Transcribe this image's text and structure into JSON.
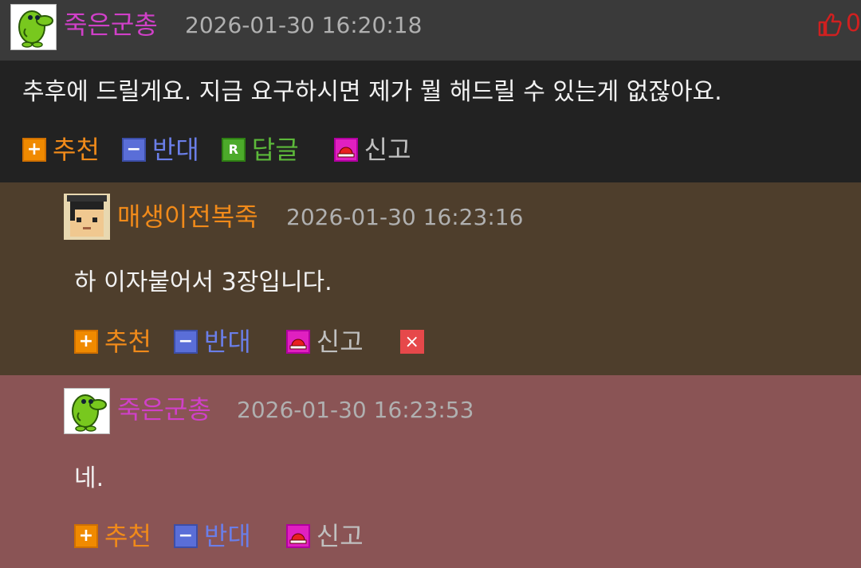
{
  "comments": [
    {
      "nickname": "죽은군총",
      "nick_color": "#d040c8",
      "timestamp": "2026-01-30 16:20:18",
      "text": "추후에 드릴게요. 지금 요구하시면 제가 뭘 해드릴 수 있는게 없잖아요.",
      "like_count": "0",
      "actions": {
        "recommend": "추천",
        "oppose": "반대",
        "reply": "답글",
        "report": "신고",
        "reply_icon": "R"
      }
    },
    {
      "nickname": "매생이전복죽",
      "nick_color": "#f08a1a",
      "timestamp": "2026-01-30 16:23:16",
      "text": "하 이자붙어서 3장입니다.",
      "actions": {
        "recommend": "추천",
        "oppose": "반대",
        "report": "신고",
        "delete_icon": "×"
      }
    },
    {
      "nickname": "죽은군총",
      "nick_color": "#d040c8",
      "timestamp": "2026-01-30 16:23:53",
      "text": "네.",
      "actions": {
        "recommend": "추천",
        "oppose": "반대",
        "report": "신고"
      }
    }
  ],
  "icons": {
    "recommend": "plus-icon",
    "oppose": "minus-icon",
    "reply": "reply-icon",
    "report": "siren-icon",
    "like": "thumbs-up-icon",
    "delete": "close-icon"
  },
  "colors": {
    "comment1_bg": "#222222",
    "comment2_bg": "#4e3e2c",
    "comment3_bg": "#8a5455",
    "recommend": "#f08a1a",
    "oppose": "#6a7ee8",
    "reply": "#5cb83a",
    "like": "#d02020"
  }
}
